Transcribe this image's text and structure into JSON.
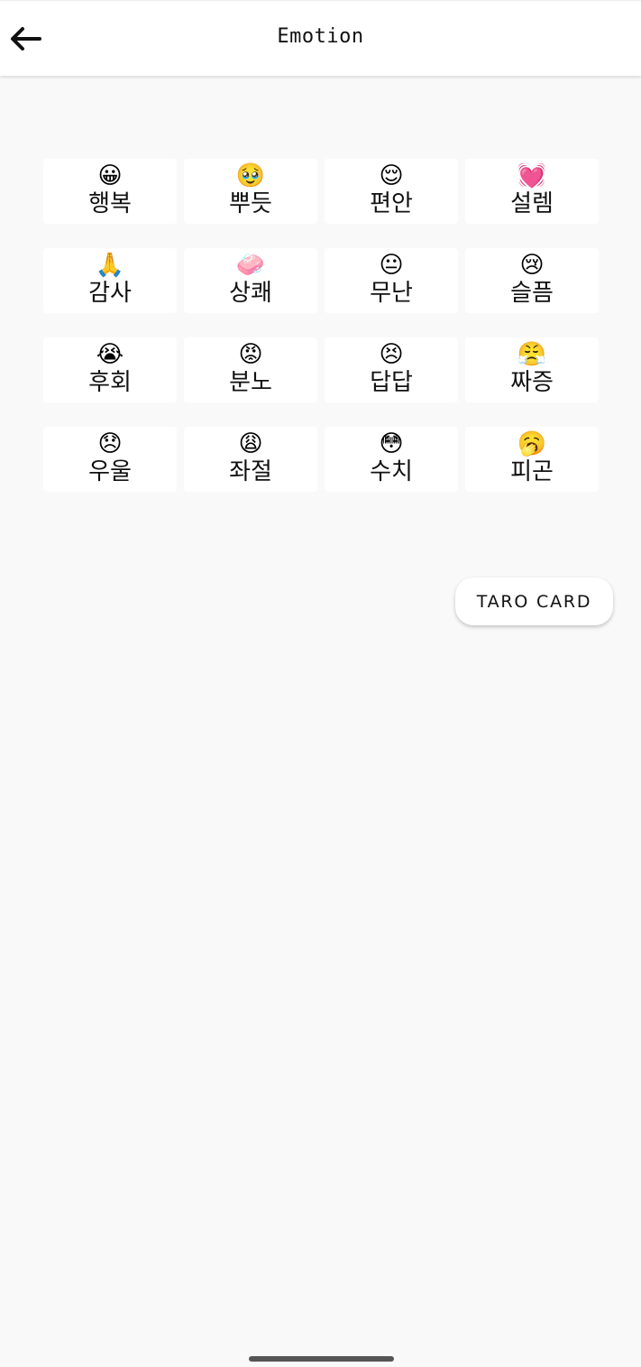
{
  "app_bar": {
    "title": "Emotion",
    "back_icon": "arrow-left-icon"
  },
  "emotions": [
    {
      "emoji": "😀",
      "label": "행복"
    },
    {
      "emoji": "🥹",
      "label": "뿌듯"
    },
    {
      "emoji": "😌",
      "label": "편안"
    },
    {
      "emoji": "💓",
      "label": "설렘"
    },
    {
      "emoji": "🙏",
      "label": "감사"
    },
    {
      "emoji": "🧼",
      "label": "상쾌"
    },
    {
      "emoji": "😐",
      "label": "무난"
    },
    {
      "emoji": "😢",
      "label": "슬픔"
    },
    {
      "emoji": "😭",
      "label": "후회"
    },
    {
      "emoji": "😡",
      "label": "분노"
    },
    {
      "emoji": "😣",
      "label": "답답"
    },
    {
      "emoji": "😤",
      "label": "짜증"
    },
    {
      "emoji": "😞",
      "label": "우울"
    },
    {
      "emoji": "😩",
      "label": "좌절"
    },
    {
      "emoji": "😳",
      "label": "수치"
    },
    {
      "emoji": "🥱",
      "label": "피곤"
    }
  ],
  "action_button": {
    "label": "TARO CARD"
  }
}
